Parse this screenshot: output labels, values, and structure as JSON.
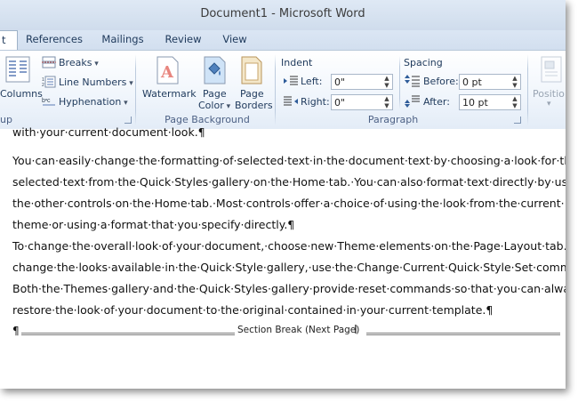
{
  "window": {
    "title": "Document1 - Microsoft Word"
  },
  "tabs": [
    {
      "label": "t"
    },
    {
      "label": "References"
    },
    {
      "label": "Mailings"
    },
    {
      "label": "Review"
    },
    {
      "label": "View"
    }
  ],
  "ribbon": {
    "page_setup": {
      "columns_label": "Columns",
      "breaks_label": "Breaks",
      "line_numbers_label": "Line Numbers",
      "hyphenation_label": "Hyphenation",
      "group_label": "up"
    },
    "page_background": {
      "watermark_label": "Watermark",
      "page_color_label_1": "Page",
      "page_color_label_2": "Color",
      "page_borders_label_1": "Page",
      "page_borders_label_2": "Borders",
      "group_label": "Page Background"
    },
    "paragraph": {
      "indent_heading": "Indent",
      "left_label": "Left:",
      "left_value": "0\"",
      "right_label": "Right:",
      "right_value": "0\"",
      "spacing_heading": "Spacing",
      "before_label": "Before:",
      "before_value": "0 pt",
      "after_label": "After:",
      "after_value": "10 pt",
      "group_label": "Paragraph"
    },
    "arrange": {
      "position_label": "Positio"
    }
  },
  "document": {
    "paragraphs": [
      {
        "lines": [
          "with·your·current·document·look.¶"
        ]
      },
      {
        "lines": [
          "You·can·easily·change·the·formatting·of·selected·text·in·the·document·text·by·choosing·a·look·for·the·",
          "selected·text·from·the·Quick·Styles·gallery·on·the·Home·tab.·You·can·also·format·text·directly·by·using·",
          "the·other·controls·on·the·Home·tab.·Most·controls·offer·a·choice·of·using·the·look·from·the·current·",
          "theme·or·using·a·format·that·you·specify·directly.¶"
        ]
      },
      {
        "lines": [
          "To·change·the·overall·look·of·your·document,·choose·new·Theme·elements·on·the·Page·Layout·tab.·To·",
          "change·the·looks·available·in·the·Quick·Style·gallery,·use·the·Change·Current·Quick·Style·Set·command.·",
          "Both·the·Themes·gallery·and·the·Quick·Styles·gallery·provide·reset·commands·so·that·you·can·always·",
          "restore·the·look·of·your·document·to·the·original·contained·in·your·current·template.¶"
        ]
      }
    ],
    "section_break_mark": "¶",
    "section_break_label": "Section Break (Next Page)"
  },
  "colors": {
    "ribbon_text": "#1e395b",
    "group_label": "#4d6185",
    "titlebar": "#dfe9f5"
  }
}
